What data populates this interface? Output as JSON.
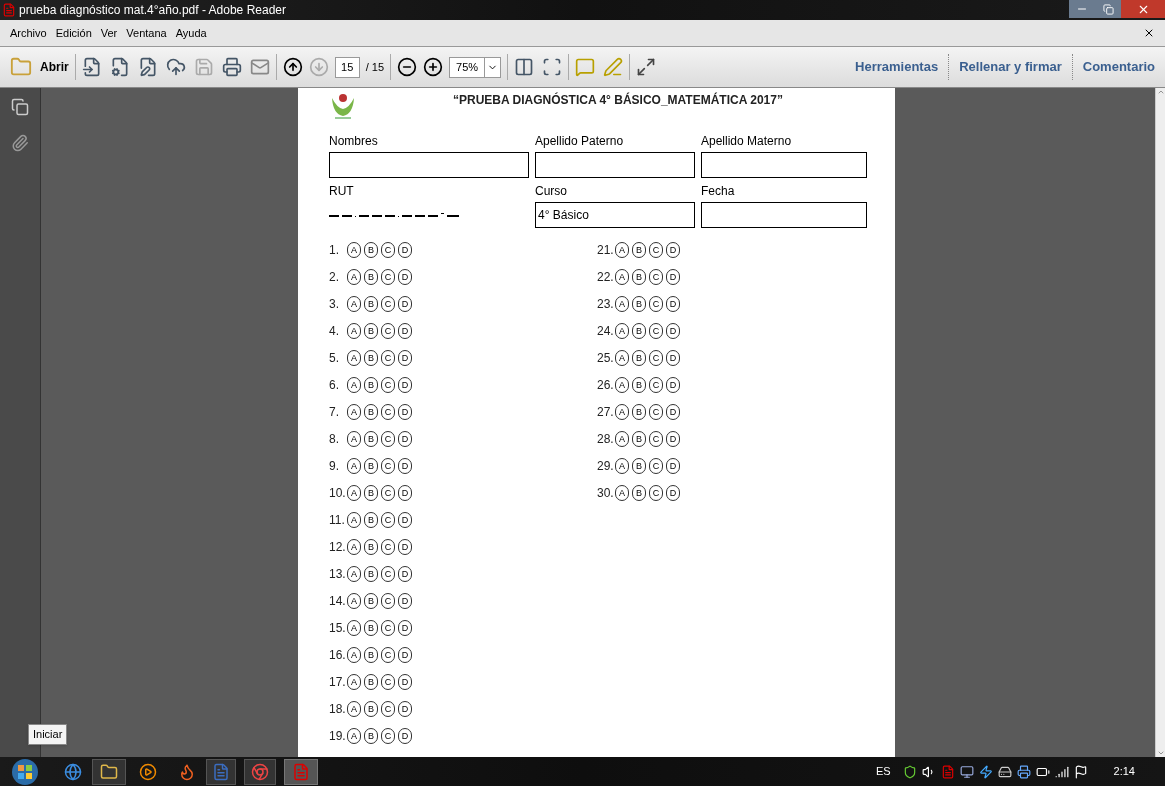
{
  "window": {
    "title": "prueba diagnóstico mat.4°año.pdf - Adobe Reader"
  },
  "menu": [
    "Archivo",
    "Edición",
    "Ver",
    "Ventana",
    "Ayuda"
  ],
  "toolbar": {
    "open_label": "Abrir",
    "page": "15",
    "page_total": "/ 15",
    "zoom": "75%"
  },
  "panels": [
    "Herramientas",
    "Rellenar y firmar",
    "Comentario"
  ],
  "document": {
    "title": "“PRUEBA DIAGNÓSTICA 4° BÁSICO_MATEMÁTICA 2017”",
    "fields": [
      {
        "label": "Nombres",
        "kind": "box"
      },
      {
        "label": "Apellido Paterno",
        "kind": "box"
      },
      {
        "label": "Apellido Materno",
        "kind": "box"
      },
      {
        "label": "RUT",
        "kind": "rut"
      },
      {
        "label": "Curso",
        "kind": "box",
        "value": "4° Básico"
      },
      {
        "label": "Fecha",
        "kind": "box"
      }
    ],
    "answers": [
      [
        {
          "number": "1.",
          "options": [
            "A",
            "B",
            "C",
            "D"
          ]
        },
        {
          "number": "2.",
          "options": [
            "A",
            "B",
            "C",
            "D"
          ]
        },
        {
          "number": "3.",
          "options": [
            "A",
            "B",
            "C",
            "D"
          ]
        },
        {
          "number": "4.",
          "options": [
            "A",
            "B",
            "C",
            "D"
          ]
        },
        {
          "number": "5.",
          "options": [
            "A",
            "B",
            "C",
            "D"
          ]
        },
        {
          "number": "6.",
          "options": [
            "A",
            "B",
            "C",
            "D"
          ]
        },
        {
          "number": "7.",
          "options": [
            "A",
            "B",
            "C",
            "D"
          ]
        },
        {
          "number": "8.",
          "options": [
            "A",
            "B",
            "C",
            "D"
          ]
        },
        {
          "number": "9.",
          "options": [
            "A",
            "B",
            "C",
            "D"
          ]
        },
        {
          "number": "10.",
          "options": [
            "A",
            "B",
            "C",
            "D"
          ]
        },
        {
          "number": "11.",
          "options": [
            "A",
            "B",
            "C",
            "D"
          ]
        },
        {
          "number": "12.",
          "options": [
            "A",
            "B",
            "C",
            "D"
          ]
        },
        {
          "number": "13.",
          "options": [
            "A",
            "B",
            "C",
            "D"
          ]
        },
        {
          "number": "14.",
          "options": [
            "A",
            "B",
            "C",
            "D"
          ]
        },
        {
          "number": "15.",
          "options": [
            "A",
            "B",
            "C",
            "D"
          ]
        },
        {
          "number": "16.",
          "options": [
            "A",
            "B",
            "C",
            "D"
          ]
        },
        {
          "number": "17.",
          "options": [
            "A",
            "B",
            "C",
            "D"
          ]
        },
        {
          "number": "18.",
          "options": [
            "A",
            "B",
            "C",
            "D"
          ]
        },
        {
          "number": "19.",
          "options": [
            "A",
            "B",
            "C",
            "D"
          ]
        }
      ],
      [
        {
          "number": "21.",
          "options": [
            "A",
            "B",
            "C",
            "D"
          ]
        },
        {
          "number": "22.",
          "options": [
            "A",
            "B",
            "C",
            "D"
          ]
        },
        {
          "number": "23.",
          "options": [
            "A",
            "B",
            "C",
            "D"
          ]
        },
        {
          "number": "24.",
          "options": [
            "A",
            "B",
            "C",
            "D"
          ]
        },
        {
          "number": "25.",
          "options": [
            "A",
            "B",
            "C",
            "D"
          ]
        },
        {
          "number": "26.",
          "options": [
            "A",
            "B",
            "C",
            "D"
          ]
        },
        {
          "number": "27.",
          "options": [
            "A",
            "B",
            "C",
            "D"
          ]
        },
        {
          "number": "28.",
          "options": [
            "A",
            "B",
            "C",
            "D"
          ]
        },
        {
          "number": "29.",
          "options": [
            "A",
            "B",
            "C",
            "D"
          ]
        },
        {
          "number": "30.",
          "options": [
            "A",
            "B",
            "C",
            "D"
          ]
        }
      ]
    ]
  },
  "tooltip": "Iniciar",
  "taskbar": {
    "language": "ES",
    "clock": "2:14"
  }
}
